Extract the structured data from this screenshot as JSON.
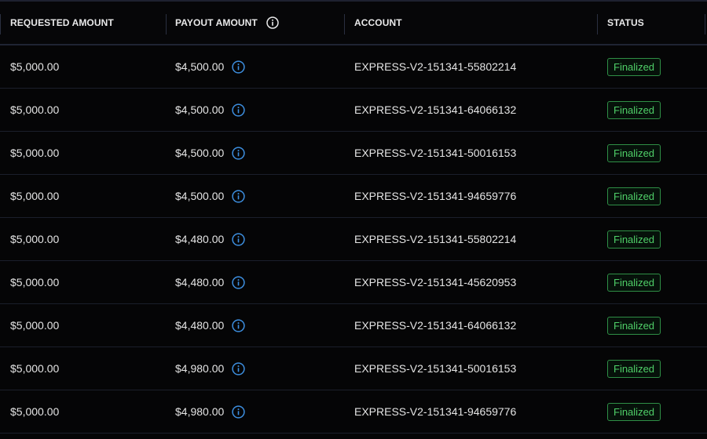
{
  "table": {
    "headers": {
      "requested": "REQUESTED AMOUNT",
      "payout": "PAYOUT AMOUNT",
      "account": "ACCOUNT",
      "status": "STATUS"
    },
    "rows": [
      {
        "requested": "$5,000.00",
        "payout": "$4,500.00",
        "account": "EXPRESS-V2-151341-55802214",
        "status": "Finalized"
      },
      {
        "requested": "$5,000.00",
        "payout": "$4,500.00",
        "account": "EXPRESS-V2-151341-64066132",
        "status": "Finalized"
      },
      {
        "requested": "$5,000.00",
        "payout": "$4,500.00",
        "account": "EXPRESS-V2-151341-50016153",
        "status": "Finalized"
      },
      {
        "requested": "$5,000.00",
        "payout": "$4,500.00",
        "account": "EXPRESS-V2-151341-94659776",
        "status": "Finalized"
      },
      {
        "requested": "$5,000.00",
        "payout": "$4,480.00",
        "account": "EXPRESS-V2-151341-55802214",
        "status": "Finalized"
      },
      {
        "requested": "$5,000.00",
        "payout": "$4,480.00",
        "account": "EXPRESS-V2-151341-45620953",
        "status": "Finalized"
      },
      {
        "requested": "$5,000.00",
        "payout": "$4,480.00",
        "account": "EXPRESS-V2-151341-64066132",
        "status": "Finalized"
      },
      {
        "requested": "$5,000.00",
        "payout": "$4,980.00",
        "account": "EXPRESS-V2-151341-50016153",
        "status": "Finalized"
      },
      {
        "requested": "$5,000.00",
        "payout": "$4,980.00",
        "account": "EXPRESS-V2-151341-94659776",
        "status": "Finalized"
      }
    ]
  },
  "icons": {
    "header_info": "info-circle-icon",
    "row_info": "info-circle-icon"
  },
  "colors": {
    "background": "#050506",
    "status_finalized": "#4fcf68",
    "info_icon": "#3d8fe0"
  }
}
